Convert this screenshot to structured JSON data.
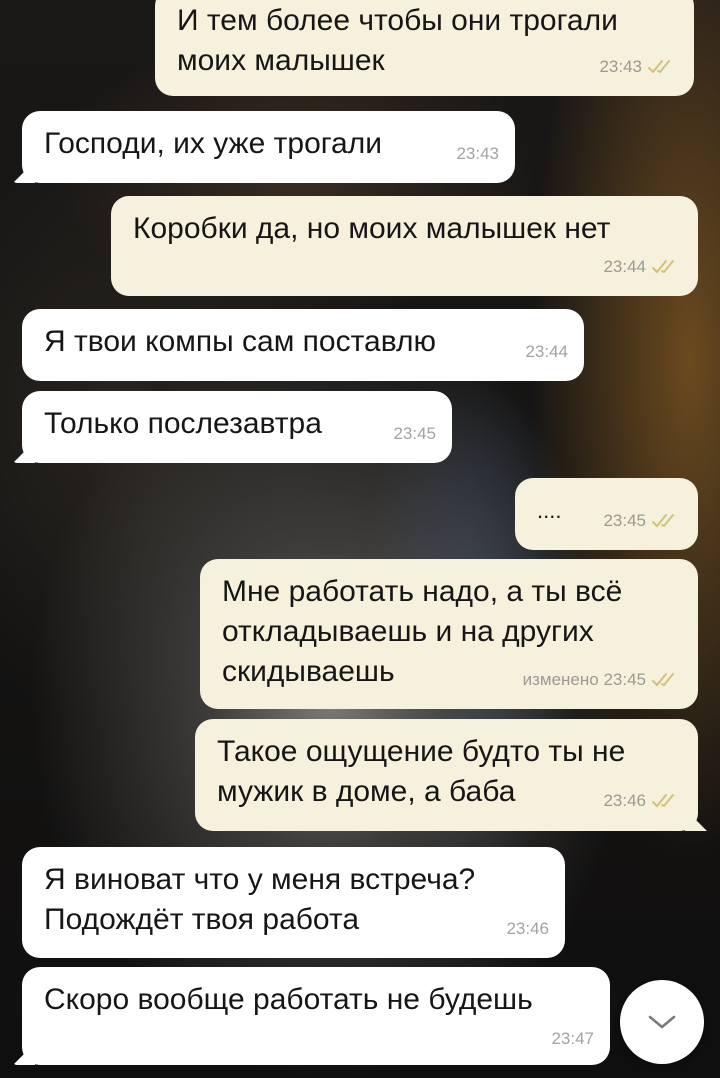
{
  "messages": [
    {
      "id": 1,
      "direction": "out",
      "text": "И тем более чтобы они трогали\nмоих малышек",
      "time": "23:43",
      "status": "read"
    },
    {
      "id": 2,
      "direction": "in",
      "text": "Господи, их уже трогали",
      "time": "23:43"
    },
    {
      "id": 3,
      "direction": "out",
      "text": "Коробки да, но моих малышек нет",
      "time": "23:44",
      "status": "read"
    },
    {
      "id": 4,
      "direction": "in",
      "text": "Я твои компы сам поставлю",
      "time": "23:44"
    },
    {
      "id": 5,
      "direction": "in",
      "text": "Только послезавтра",
      "time": "23:45"
    },
    {
      "id": 6,
      "direction": "out",
      "text": "....",
      "time": "23:45",
      "status": "read"
    },
    {
      "id": 7,
      "direction": "out",
      "text": "Мне работать надо, а ты всё\nоткладываешь и на других\nскидываешь",
      "time": "изменено 23:45",
      "status": "read"
    },
    {
      "id": 8,
      "direction": "out",
      "text": "Такое ощущение будто ты не\nмужик в доме, а баба",
      "time": "23:46",
      "status": "read"
    },
    {
      "id": 9,
      "direction": "in",
      "text": "Я виноват что у меня встреча?\nПодождёт твоя работа",
      "time": "23:46"
    },
    {
      "id": 10,
      "direction": "in",
      "text": "Скоро вообще работать не будешь",
      "time": "23:47"
    }
  ],
  "scroll_button": {
    "icon": "chevron-down-icon"
  },
  "colors": {
    "outgoing": "#f6f1dd",
    "incoming": "#ffffff",
    "read_ticks": "#d1c27a"
  }
}
